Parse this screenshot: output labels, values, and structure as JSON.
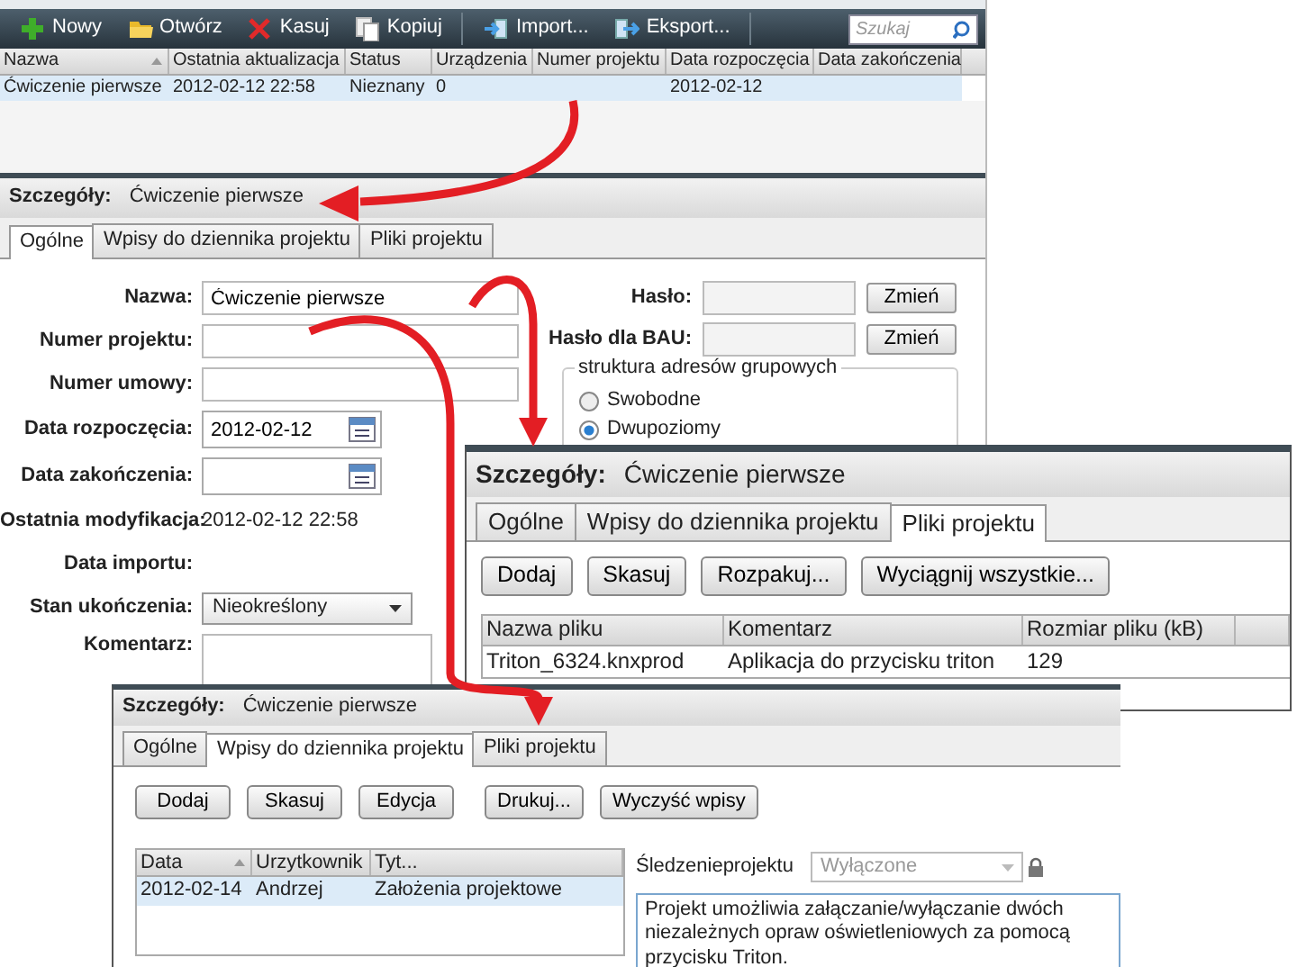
{
  "main": {
    "toolbar": {
      "buttons": [
        {
          "label": "Nowy",
          "kind": "plus"
        },
        {
          "label": "Otwórz",
          "kind": "folder"
        },
        {
          "label": "Kasuj",
          "kind": "cross"
        },
        {
          "label": "Kopiuj",
          "kind": "copy"
        },
        {
          "label": "Import...",
          "kind": "import"
        },
        {
          "label": "Eksport...",
          "kind": "export"
        }
      ],
      "search": {
        "placeholder": "Szukaj"
      }
    },
    "table": {
      "columns": [
        {
          "label": "Nazwa",
          "sorted": true
        },
        {
          "label": "Ostatnia aktualizacja",
          "sorted": false
        },
        {
          "label": "Status",
          "sorted": false
        },
        {
          "label": "Urządzenia",
          "sorted": false
        },
        {
          "label": "Numer projektu",
          "sorted": false
        },
        {
          "label": "Data rozpoczęcia",
          "sorted": false
        },
        {
          "label": "Data zakończenia",
          "sorted": false
        }
      ],
      "rows": [
        {
          "cells": [
            "Ćwiczenie pierwsze",
            "2012-02-12 22:58",
            "Nieznany",
            "0",
            "",
            "2012-02-12",
            ""
          ],
          "selected": true
        }
      ]
    },
    "details": {
      "label": "Szczegóły:",
      "title": "Ćwiczenie pierwsze"
    },
    "tabs": [
      {
        "label": "Ogólne",
        "selected": true
      },
      {
        "label": "Wpisy do dziennika projektu",
        "selected": false
      },
      {
        "label": "Pliki projektu",
        "selected": false
      }
    ],
    "fields": [
      {
        "label": "Nazwa:",
        "kind": "text",
        "value": "Ćwiczenie pierwsze"
      },
      {
        "label": "Numer projektu:",
        "kind": "text"
      },
      {
        "label": "Numer umowy:",
        "kind": "text"
      },
      {
        "label": "Data rozpoczęcia:",
        "kind": "date",
        "value": "2012-02-12"
      },
      {
        "label": "Data zakończenia:",
        "kind": "date"
      },
      {
        "label": "Ostatnia modyfikacja:",
        "kind": "static",
        "value": "2012-02-12 22:58"
      },
      {
        "label": "Data importu:",
        "kind": "static"
      },
      {
        "label": "Stan ukończenia:",
        "kind": "select",
        "value": "Nieokreślony"
      },
      {
        "label": "Komentarz:",
        "kind": "textarea"
      }
    ],
    "passwords": [
      {
        "label": "Hasło:",
        "button": "Zmień"
      },
      {
        "label": "Hasło dla BAU:",
        "button": "Zmień"
      }
    ],
    "group": {
      "title": "struktura adresów grupowych",
      "options": [
        {
          "label": "Swobodne",
          "selected": false
        },
        {
          "label": "Dwupoziomy",
          "selected": true
        }
      ]
    }
  },
  "files_panel": {
    "details": {
      "label": "Szczegóły:",
      "title": "Ćwiczenie pierwsze"
    },
    "tabs": [
      {
        "label": "Ogólne",
        "selected": false
      },
      {
        "label": "Wpisy do dziennika projektu",
        "selected": false
      },
      {
        "label": "Pliki projektu",
        "selected": true
      }
    ],
    "buttons": [
      "Dodaj",
      "Skasuj",
      "Rozpakuj...",
      "Wyciągnij wszystkie..."
    ],
    "columns": [
      "Nazwa pliku",
      "Komentarz",
      "Rozmiar pliku (kB)"
    ],
    "rows": [
      {
        "cells": [
          "Triton_6324.knxprod",
          "Aplikacja do przycisku triton",
          "129"
        ]
      }
    ]
  },
  "log_panel": {
    "details": {
      "label": "Szczegóły:",
      "title": "Ćwiczenie pierwsze"
    },
    "tabs": [
      {
        "label": "Ogólne",
        "selected": false
      },
      {
        "label": "Wpisy do dziennika projektu",
        "selected": true
      },
      {
        "label": "Pliki projektu",
        "selected": false
      }
    ],
    "buttons": [
      "Dodaj",
      "Skasuj",
      "Edycja",
      "Drukuj...",
      "Wyczyść wpisy"
    ],
    "columns": [
      {
        "label": "Data",
        "sorted": true
      },
      {
        "label": "Urzytkownik",
        "sorted": false
      },
      {
        "label": "Tyt...",
        "sorted": false
      }
    ],
    "rows": [
      {
        "cells": [
          "2012-02-14",
          "Andrzej",
          "Założenia projektowe"
        ],
        "selected": true
      }
    ],
    "tracking": {
      "label": "Śledzenieprojektu",
      "value": "Wyłączone",
      "disabled": true,
      "locked": true
    },
    "description": "Projekt umożliwia załączanie/wyłączanie dwóch niezależnych opraw oświetleniowych za pomocą przycisku Triton."
  }
}
